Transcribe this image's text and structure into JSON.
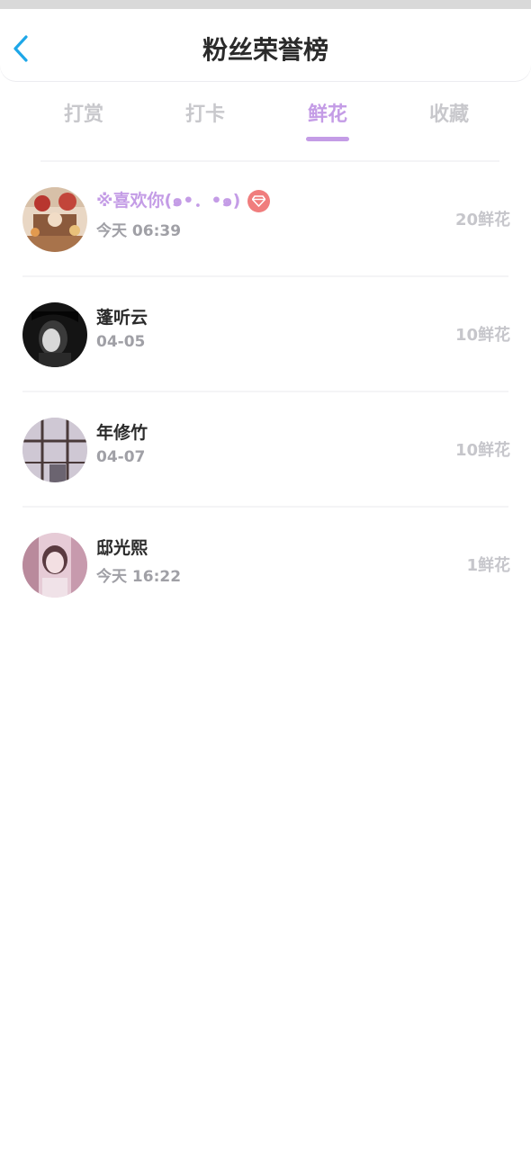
{
  "header": {
    "title": "粉丝荣誉榜",
    "back_icon": "chevron-left-icon",
    "accent_color": "#1ea7e8"
  },
  "tabs": [
    {
      "label": "打赏",
      "active": false
    },
    {
      "label": "打卡",
      "active": false
    },
    {
      "label": "鲜花",
      "active": true
    },
    {
      "label": "收藏",
      "active": false
    }
  ],
  "theme": {
    "active_tab_color": "#c49ce6",
    "inactive_tab_color": "#c8c8cc",
    "badge_color": "#f07d7d"
  },
  "fans": [
    {
      "name": "※喜欢你(๑•．•๑)",
      "time": "今天 06:39",
      "count": "20鲜花",
      "highlight": true,
      "badge": "diamond-badge-icon"
    },
    {
      "name": "蓬听云",
      "time": "04-05",
      "count": "10鲜花",
      "highlight": false
    },
    {
      "name": "年修竹",
      "time": "04-07",
      "count": "10鲜花",
      "highlight": false
    },
    {
      "name": "邸光熙",
      "time": "今天 16:22",
      "count": "1鲜花",
      "highlight": false
    }
  ]
}
